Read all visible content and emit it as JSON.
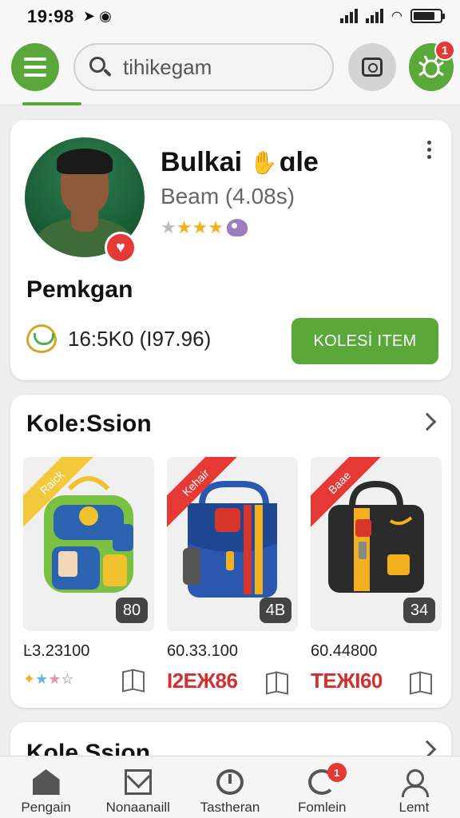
{
  "status_bar": {
    "time": "19:98",
    "time_icons": "➤ ◉"
  },
  "app_bar": {
    "search": {
      "value": "tihikegam"
    },
    "notification_count": "1"
  },
  "profile": {
    "name_part1": "Bulkai",
    "name_part2": "ɑle",
    "subtitle": "Beam  (4.08s)",
    "title": "Pemkgan",
    "coins": "16:5K0 (I97.96)",
    "action_button": "KOLESİ ITEM"
  },
  "collection": {
    "title": "Kole:Ssion",
    "items": [
      {
        "ribbon": "Raick",
        "ribbon_color": "#f1c93b",
        "count": "80",
        "price": "Ŀ3.23100",
        "code": "",
        "bag_colors": [
          "#7ac143",
          "#2c63b0",
          "#f2c12e"
        ]
      },
      {
        "ribbon": "Kehair",
        "ribbon_color": "#e53935",
        "count": "4B",
        "price": "60.33.100",
        "code": "I2EЖ86",
        "bag_colors": [
          "#2a57b0",
          "#d7352c",
          "#f2b01e"
        ]
      },
      {
        "ribbon": "Baae",
        "ribbon_color": "#e53935",
        "count": "34",
        "price": "60.44800",
        "code": "TEЖI60",
        "bag_colors": [
          "#2b2b2b",
          "#f2b01e",
          "#d7352c"
        ]
      }
    ]
  },
  "collection_peek": {
    "title": "Kole.Ssion"
  },
  "bottom_nav": {
    "items": [
      {
        "label": "Pengain"
      },
      {
        "label": "Nonaanaill"
      },
      {
        "label": "Tastheran"
      },
      {
        "label": "Fomlein",
        "badge": "1"
      },
      {
        "label": "Lemt"
      }
    ]
  },
  "colors": {
    "accent_green": "#5aa83a",
    "badge_red": "#e53935",
    "code_red": "#d32f2f",
    "star_gold": "#f2b01e"
  }
}
